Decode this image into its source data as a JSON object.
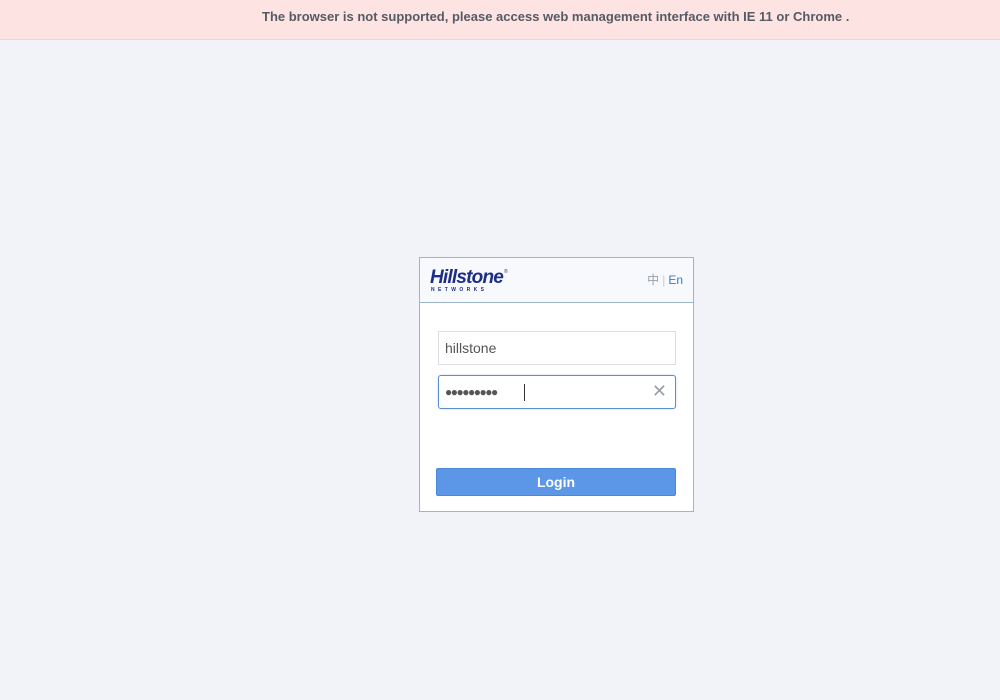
{
  "banner": {
    "message": "The browser is not supported, please access web management interface with IE 11 or Chrome ."
  },
  "brand": {
    "logo_text": "Hillstone",
    "logo_sub": "NETWORKS",
    "logo_mark": "®",
    "color": "#1c2e86"
  },
  "language": {
    "zh_label": "中",
    "separator": "|",
    "en_label": "En",
    "selected": "En"
  },
  "form": {
    "username_value": "hillstone",
    "password_masked": "●●●●●●●●●",
    "clear_icon": "✕",
    "login_label": "Login"
  },
  "colors": {
    "accent": "#5b97e6",
    "banner_bg": "#fde3e1",
    "link": "#2f7fc1"
  }
}
